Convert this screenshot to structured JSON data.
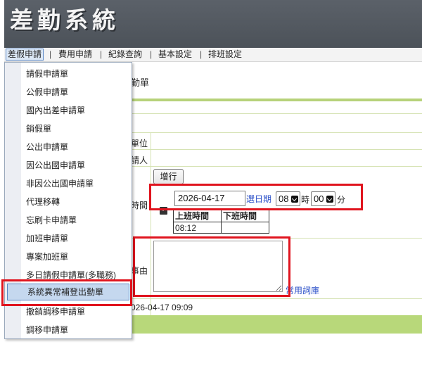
{
  "app": {
    "title": "差勤系統"
  },
  "menu": {
    "items": [
      {
        "label": "差假申請",
        "active": true
      },
      {
        "label": "費用申請",
        "active": false
      },
      {
        "label": "紀錄查詢",
        "active": false
      },
      {
        "label": "基本設定",
        "active": false
      },
      {
        "label": "排班設定",
        "active": false
      }
    ],
    "separator": "|"
  },
  "dropdown": {
    "items": [
      {
        "label": "請假申請單"
      },
      {
        "label": "公假申請單"
      },
      {
        "label": "國內出差申請單"
      },
      {
        "label": "銷假單"
      },
      {
        "label": "公出申請單"
      },
      {
        "label": "因公出國申請單"
      },
      {
        "label": "非因公出國申請單"
      },
      {
        "label": "代理移轉"
      },
      {
        "label": "忘刷卡申請單"
      },
      {
        "label": "加班申請單"
      },
      {
        "label": "專案加班單"
      },
      {
        "label": "多日請假申請單(多職務)"
      },
      {
        "label": "系統異常補登出勤單",
        "selected": true
      },
      {
        "label": "撤銷調移申請單"
      },
      {
        "label": "調移申請單"
      }
    ]
  },
  "form": {
    "title_fragment": "勤單",
    "unit_label_fragment": "單位",
    "applicant_label_fragment": "請人",
    "time_label_fragment": "時間",
    "reason_label_fragment": "事由",
    "add_button": "增行",
    "date_value": "2026-04-17",
    "pick_date_link": "選日期",
    "hour_value": "08",
    "hour_unit": "時",
    "minute_value": "00",
    "minute_unit": "分",
    "shift_table": {
      "headers": [
        "上班時間",
        "下班時間"
      ],
      "rows": [
        [
          "08:12",
          ""
        ]
      ]
    },
    "common_phrases_link": "常用詞庫",
    "created_fragment": "026-04-17 09:09"
  },
  "colors": {
    "highlight_box": "#e0141e",
    "accent_green": "#b8d87a",
    "link": "#2b50c9"
  }
}
